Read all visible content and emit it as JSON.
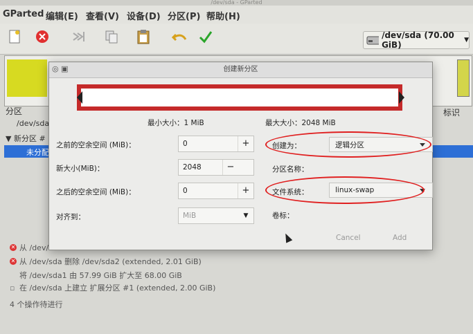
{
  "window": {
    "title": "/dev/sda - GParted"
  },
  "menubar": {
    "items": [
      "GParted",
      "编辑(E)",
      "查看(V)",
      "设备(D)",
      "分区(P)",
      "帮助(H)"
    ]
  },
  "toolbar": {
    "icons": [
      "new-icon",
      "delete-icon",
      "resize-icon",
      "copy-icon",
      "paste-icon",
      "undo-icon",
      "apply-icon"
    ],
    "device": "/dev/sda  (70.00 GiB)"
  },
  "background": {
    "partition_header": "分区",
    "partition_header_right": "标识",
    "tree_items": [
      "/dev/sda",
      "新分区 #",
      "未分配"
    ]
  },
  "operations": [
    {
      "text": "从 /dev/",
      "icon": "delete-icon"
    },
    {
      "text": "从 /dev/sda 删除 /dev/sda2 (extended, 2.01 GiB)",
      "icon": "delete-icon"
    },
    {
      "text": "将 /dev/sda1 由 57.99 GiB 扩大至 68.00 GiB",
      "icon": "resize-icon"
    },
    {
      "text": "在 /dev/sda 上建立 扩展分区 #1 (extended, 2.00 GiB)",
      "icon": "new-icon"
    },
    {
      "text": "4 个操作待进行",
      "icon": ""
    }
  ],
  "dialog": {
    "title": "创建新分区",
    "min_size": "最小大小：1 MiB",
    "max_size": "最大大小：2048 MiB",
    "free_before_label": "之前的空余空间 (MiB)：",
    "free_before_value": "0",
    "new_size_label": "新大小(MiB)：",
    "new_size_value": "2048",
    "free_after_label": "之后的空余空间 (MiB)：",
    "free_after_value": "0",
    "align_label": "对齐到：",
    "align_value": "MiB",
    "create_as_label": "创建为：",
    "create_as_value": "逻辑分区",
    "name_label": "分区名称：",
    "fs_label": "文件系统：",
    "fs_value": "linux-swap",
    "volume_label": "卷标：",
    "cancel": "Cancel",
    "add": "Add"
  },
  "colors": {
    "highlight": "#c52a2a",
    "annotation": "#e02020",
    "selection": "#2d6fd6",
    "partition_fill": "#d7da21"
  }
}
